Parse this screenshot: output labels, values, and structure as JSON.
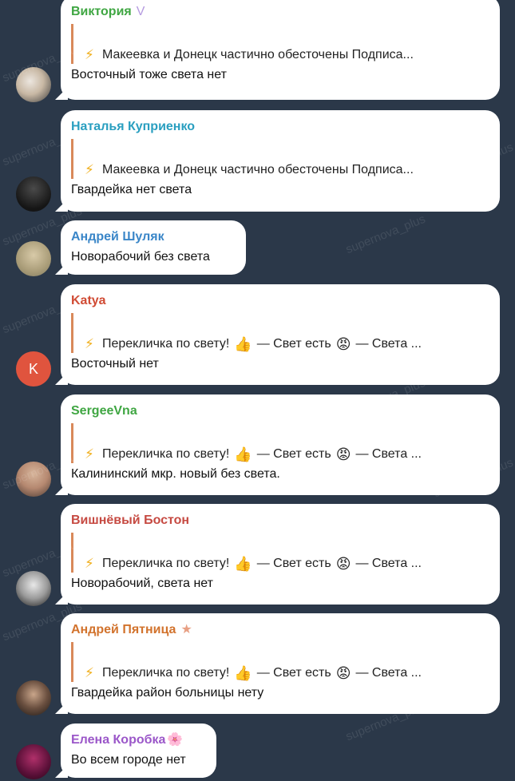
{
  "colors": {
    "background": "#2b3849",
    "reply_bar": "#d9895a",
    "avatar_letter_bg": "#e0543e"
  },
  "watermark": "supernova_plus",
  "messages": [
    {
      "sender": "Виктория",
      "sender_color": "#3fa642",
      "badge": "V",
      "badge_color": "#b59be0",
      "avatar_style": "photo",
      "reply": {
        "icon": "⚡",
        "text": "Макеевка и Донецк частично обесточены  Подписа..."
      },
      "text": "Восточный тоже света нет"
    },
    {
      "sender": "Наталья Куприенко",
      "sender_color": "#2a9fc0",
      "avatar_style": "photo",
      "reply": {
        "icon": "⚡",
        "text": "Макеевка и Донецк частично обесточены  Подписа..."
      },
      "text": "Гвардейка нет света"
    },
    {
      "sender": "Андрей Шуляк",
      "sender_color": "#3a86c8",
      "avatar_style": "photo",
      "text": "Новорабочий без света"
    },
    {
      "sender": "Katya",
      "sender_color": "#d04a33",
      "avatar_style": "letter",
      "avatar_letter": "K",
      "reply": {
        "icon": "⚡",
        "part1": "Перекличка по свету!",
        "emoji1": "👍",
        "part2": "— Свет есть",
        "emoji2": "😡",
        "part3": "— Света ..."
      },
      "text": "Восточный нет"
    },
    {
      "sender": "SergeeVna",
      "sender_color": "#3fa642",
      "avatar_style": "photo",
      "reply": {
        "icon": "⚡",
        "part1": "Перекличка по свету!",
        "emoji1": "👍",
        "part2": "— Свет есть",
        "emoji2": "😡",
        "part3": "— Света ..."
      },
      "text": "Калининский мкр. новый без света."
    },
    {
      "sender": "Вишнёвый Бостон",
      "sender_color": "#c64a42",
      "avatar_style": "photo",
      "reply": {
        "icon": "⚡",
        "part1": "Перекличка по свету!",
        "emoji1": "👍",
        "part2": "— Свет есть",
        "emoji2": "😡",
        "part3": "— Света ..."
      },
      "text": "Новорабочий, света нет"
    },
    {
      "sender": "Андрей Пятница",
      "sender_color": "#d2732d",
      "badge": "★",
      "badge_color": "#e8a084",
      "avatar_style": "photo",
      "reply": {
        "icon": "⚡",
        "part1": "Перекличка по свету!",
        "emoji1": "👍",
        "part2": "— Свет есть",
        "emoji2": "😡",
        "part3": "— Света ..."
      },
      "text": "Гвардейка район больницы нету"
    },
    {
      "sender": "Елена Коробка",
      "sender_color": "#9b57c9",
      "badge": "🌸",
      "avatar_style": "photo",
      "text": "Во всем городе нет"
    }
  ]
}
